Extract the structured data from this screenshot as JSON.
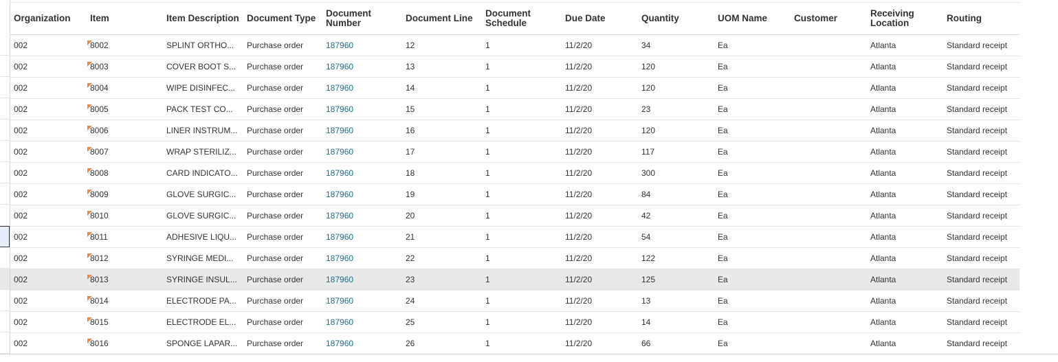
{
  "columns": [
    "Organization",
    "Item",
    "Item Description",
    "Document Type",
    "Document Number",
    "Document Line",
    "Document Schedule",
    "Due Date",
    "Quantity",
    "UOM Name",
    "Customer",
    "Receiving Location",
    "Routing"
  ],
  "rows": [
    {
      "org": "002",
      "item": "8002",
      "desc": "SPLINT ORTHO...",
      "type": "Purchase order",
      "number": "187960",
      "line": "12",
      "schedule": "1",
      "due": "11/2/20",
      "qty": "34",
      "uom": "Ea",
      "customer": "",
      "location": "Atlanta",
      "routing": "Standard receipt"
    },
    {
      "org": "002",
      "item": "8003",
      "desc": "COVER BOOT S...",
      "type": "Purchase order",
      "number": "187960",
      "line": "13",
      "schedule": "1",
      "due": "11/2/20",
      "qty": "120",
      "uom": "Ea",
      "customer": "",
      "location": "Atlanta",
      "routing": "Standard receipt"
    },
    {
      "org": "002",
      "item": "8004",
      "desc": "WIPE DISINFEC...",
      "type": "Purchase order",
      "number": "187960",
      "line": "14",
      "schedule": "1",
      "due": "11/2/20",
      "qty": "120",
      "uom": "Ea",
      "customer": "",
      "location": "Atlanta",
      "routing": "Standard receipt"
    },
    {
      "org": "002",
      "item": "8005",
      "desc": "PACK TEST CO...",
      "type": "Purchase order",
      "number": "187960",
      "line": "15",
      "schedule": "1",
      "due": "11/2/20",
      "qty": "23",
      "uom": "Ea",
      "customer": "",
      "location": "Atlanta",
      "routing": "Standard receipt"
    },
    {
      "org": "002",
      "item": "8006",
      "desc": "LINER INSTRUM...",
      "type": "Purchase order",
      "number": "187960",
      "line": "16",
      "schedule": "1",
      "due": "11/2/20",
      "qty": "120",
      "uom": "Ea",
      "customer": "",
      "location": "Atlanta",
      "routing": "Standard receipt"
    },
    {
      "org": "002",
      "item": "8007",
      "desc": "WRAP STERILIZ...",
      "type": "Purchase order",
      "number": "187960",
      "line": "17",
      "schedule": "1",
      "due": "11/2/20",
      "qty": "117",
      "uom": "Ea",
      "customer": "",
      "location": "Atlanta",
      "routing": "Standard receipt"
    },
    {
      "org": "002",
      "item": "8008",
      "desc": "CARD INDICATO...",
      "type": "Purchase order",
      "number": "187960",
      "line": "18",
      "schedule": "1",
      "due": "11/2/20",
      "qty": "300",
      "uom": "Ea",
      "customer": "",
      "location": "Atlanta",
      "routing": "Standard receipt"
    },
    {
      "org": "002",
      "item": "8009",
      "desc": "GLOVE SURGIC...",
      "type": "Purchase order",
      "number": "187960",
      "line": "19",
      "schedule": "1",
      "due": "11/2/20",
      "qty": "84",
      "uom": "Ea",
      "customer": "",
      "location": "Atlanta",
      "routing": "Standard receipt"
    },
    {
      "org": "002",
      "item": "8010",
      "desc": "GLOVE SURGIC...",
      "type": "Purchase order",
      "number": "187960",
      "line": "20",
      "schedule": "1",
      "due": "11/2/20",
      "qty": "42",
      "uom": "Ea",
      "customer": "",
      "location": "Atlanta",
      "routing": "Standard receipt"
    },
    {
      "org": "002",
      "item": "8011",
      "desc": "ADHESIVE LIQU...",
      "type": "Purchase order",
      "number": "187960",
      "line": "21",
      "schedule": "1",
      "due": "11/2/20",
      "qty": "54",
      "uom": "Ea",
      "customer": "",
      "location": "Atlanta",
      "routing": "Standard receipt"
    },
    {
      "org": "002",
      "item": "8012",
      "desc": "SYRINGE MEDI...",
      "type": "Purchase order",
      "number": "187960",
      "line": "22",
      "schedule": "1",
      "due": "11/2/20",
      "qty": "122",
      "uom": "Ea",
      "customer": "",
      "location": "Atlanta",
      "routing": "Standard receipt"
    },
    {
      "org": "002",
      "item": "8013",
      "desc": "SYRINGE INSUL...",
      "type": "Purchase order",
      "number": "187960",
      "line": "23",
      "schedule": "1",
      "due": "11/2/20",
      "qty": "125",
      "uom": "Ea",
      "customer": "",
      "location": "Atlanta",
      "routing": "Standard receipt"
    },
    {
      "org": "002",
      "item": "8014",
      "desc": "ELECTRODE PA...",
      "type": "Purchase order",
      "number": "187960",
      "line": "24",
      "schedule": "1",
      "due": "11/2/20",
      "qty": "13",
      "uom": "Ea",
      "customer": "",
      "location": "Atlanta",
      "routing": "Standard receipt"
    },
    {
      "org": "002",
      "item": "8015",
      "desc": "ELECTRODE EL...",
      "type": "Purchase order",
      "number": "187960",
      "line": "25",
      "schedule": "1",
      "due": "11/2/20",
      "qty": "14",
      "uom": "Ea",
      "customer": "",
      "location": "Atlanta",
      "routing": "Standard receipt"
    },
    {
      "org": "002",
      "item": "8016",
      "desc": "SPONGE LAPAR...",
      "type": "Purchase order",
      "number": "187960",
      "line": "26",
      "schedule": "1",
      "due": "11/2/20",
      "qty": "66",
      "uom": "Ea",
      "customer": "",
      "location": "Atlanta",
      "routing": "Standard receipt"
    }
  ],
  "colors": {
    "link": "#1f6e8c",
    "flag": "#e08a4f",
    "hover_row": "#e9e9ea",
    "selected_gutter": "#e5eef8"
  },
  "state": {
    "hovered_row_index": 11,
    "active_gutter_row_index": 9
  }
}
